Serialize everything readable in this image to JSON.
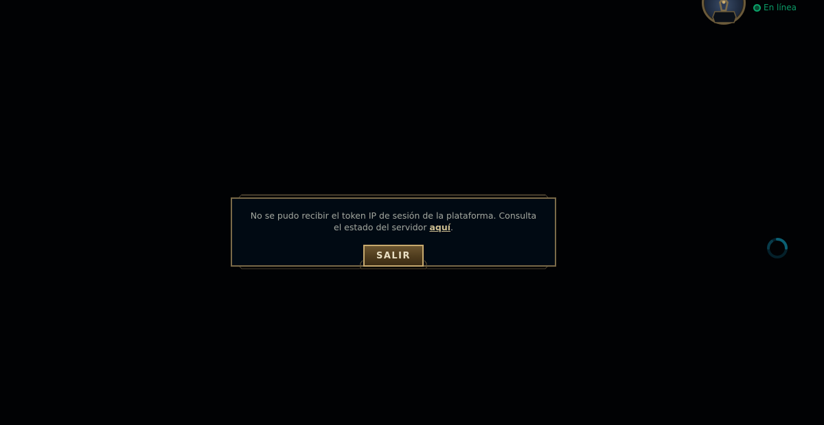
{
  "profile": {
    "status_text": "En línea",
    "status_color": "#0b9b67",
    "avatar_icon": "summoner-avatar-icon",
    "frame_color": "#6b5a3a"
  },
  "loading": {
    "icon": "loading-spinner-icon",
    "color": "#0a5a6e"
  },
  "dialog": {
    "message_prefix": "No se pudo recibir el token IP de sesión de la plataforma. Consulta el estado del servidor ",
    "link_text": "aquí",
    "message_suffix": ".",
    "button_label": "SALIR",
    "border_color": "#7a6a48",
    "background_color": "#010a13",
    "link_color": "#cdbe91",
    "button_gold": "#c8aa6e"
  },
  "colors": {
    "background": "#010204"
  }
}
